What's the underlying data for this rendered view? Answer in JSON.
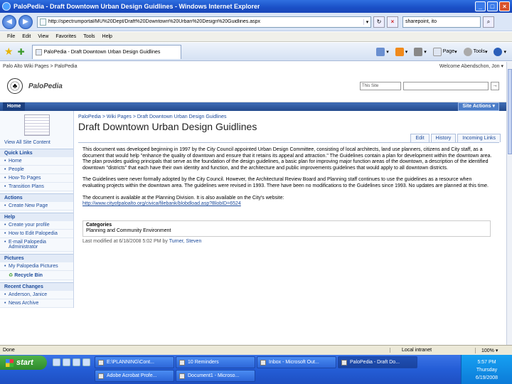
{
  "window": {
    "title": "PaloPedia - Draft Downtown Urban Design Guidlines - Windows Internet Explorer"
  },
  "address": {
    "url": "http://spectrumportal/MU%20Dept/Draft%20Downtown%20Urban%20Design%20Guidlines.aspx",
    "search_placeholder": "sharepoint, ito"
  },
  "menubar": [
    "File",
    "Edit",
    "View",
    "Favorites",
    "Tools",
    "Help"
  ],
  "tab": {
    "label": "PaloPedia - Draft Downtown Urban Design Guidlines"
  },
  "commands": {
    "page": "Page",
    "tools": "Tools"
  },
  "site": {
    "breadcrumb_top": "Palo Alto Wiki Pages > PaloPedia",
    "welcome": "Welcome Abendschon, Jon ▾",
    "name": "PaloPedia",
    "search_scope": "This Site",
    "go_label": "→",
    "home_tab": "Home",
    "site_actions": "Site Actions ▾"
  },
  "leftnav": {
    "view_all": "View All Site Content",
    "quick_links_head": "Quick Links",
    "quick_links": [
      "Home",
      "People",
      "How-To Pages",
      "Transition Plans"
    ],
    "actions_head": "Actions",
    "actions": [
      "Create New Page"
    ],
    "help_head": "Help",
    "help": [
      "Create your profile",
      "How to Edit Palopedia",
      "E-mail Palopedia Administrator"
    ],
    "pictures_head": "Pictures",
    "pictures": [
      "My Palopedia Pictures"
    ],
    "recycle_bin": "Recycle Bin",
    "recent_head": "Recent Changes",
    "recent": [
      "Anderson, Janice",
      "News Archive"
    ]
  },
  "main": {
    "breadcrumb": "PaloPedia > Wiki Pages > Draft Downtown Urban Design Guidlines",
    "title": "Draft Downtown Urban Design Guidlines",
    "tabs": [
      "Edit",
      "History",
      "Incoming Links"
    ],
    "para1": "This document was developed beginning in 1997 by the City Council appointed Urban Design Committee, consisting of local architects, land use planners, citizens and City staff, as a document that would help \"enhance the quality of downtown and ensure that it retains its appeal and attraction.\" The Guidelines contain a plan for development within the downtown area. The plan provides guiding principals that serve as the foundation of the design guidelines, a basic plan for improving major function areas of the downtown, a description of the identified downtown \"districts\" that each have their own identity and function, and the architecture and public improvements guidelines that would apply to all downtown districts.",
    "para2": "The Guidelines were never formally adopted by the City Council. However, the Architectural Review Board and Planning staff continues to use the guidelines as a resource when evaluating projects within the downtown area. The guidelines were revised in 1993. There have been no modifications to the Guidelines since 1993. No updates are planned at this time.",
    "para3": "The document is available at the Planning Division. It is also available on the City's website:",
    "link": "http://www.cityofpaloalto.org/civica/filebank/blobdload.asp?BlobID=6524",
    "categories_head": "Categories",
    "categories_value": "Planning and Community Environment",
    "last_modified_prefix": "Last modified at 6/18/2008 5:02 PM by",
    "last_modified_user": "Turner, Steven"
  },
  "status": {
    "done": "Done",
    "zone": "Local intranet",
    "zoom": "100% ▾"
  },
  "taskbar": {
    "start": "start",
    "tasks": [
      "E:\\PLANNING\\Cont...",
      "10 Reminders",
      "Inbox - Microsoft Out...",
      "PaloPedia - Draft Do...",
      "Adobe Acrobat Profe...",
      "Document1 - Microso..."
    ],
    "time": "5:57 PM",
    "day": "Thursday",
    "date": "6/19/2008"
  }
}
